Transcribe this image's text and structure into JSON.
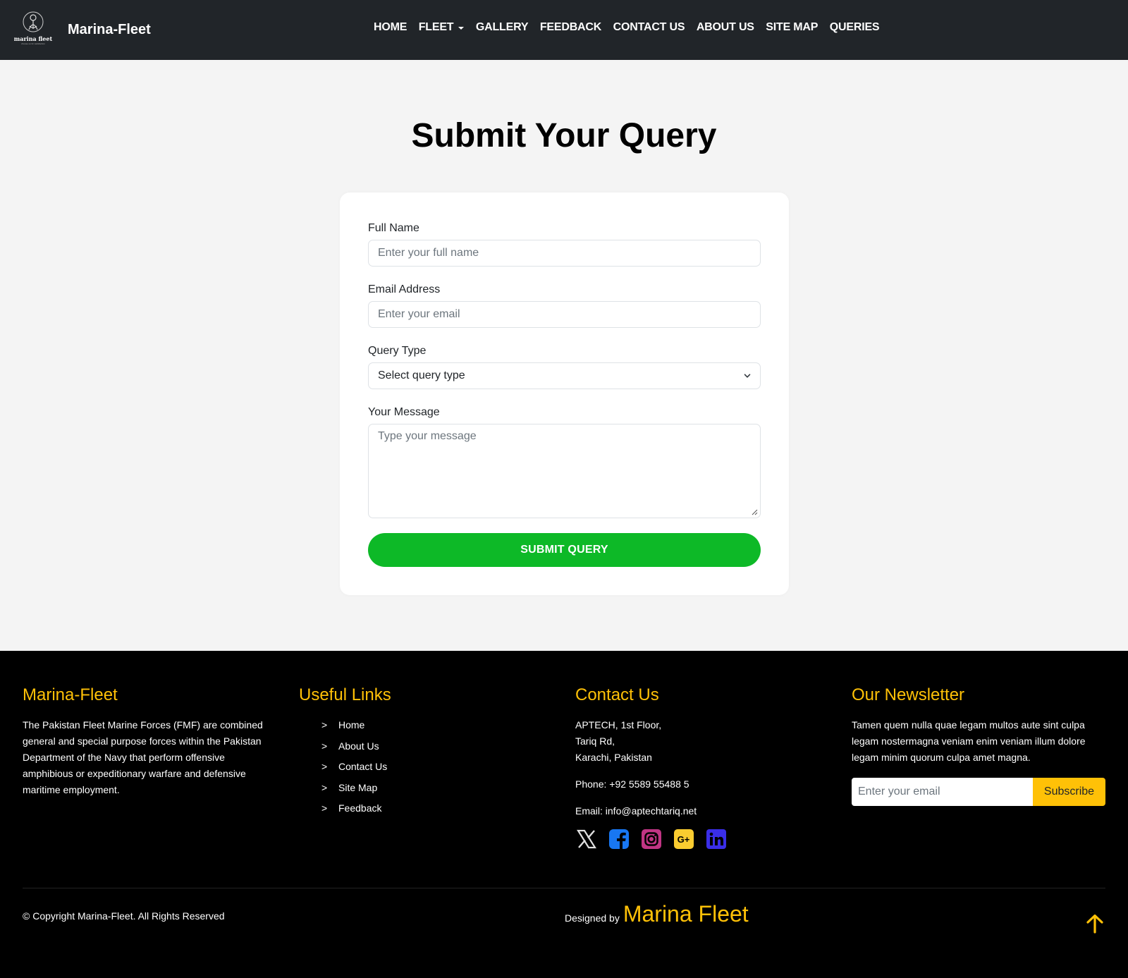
{
  "colors": {
    "navbar_bg": "#212529",
    "accent": "#ffc107",
    "submit_green": "#0db927",
    "footer_bg": "#000000"
  },
  "navbar": {
    "logo": {
      "text": "marina fleet",
      "tagline": "choose us for satisfaction",
      "icon": "anchor-sailor-icon"
    },
    "brand": "Marina-Fleet",
    "links": [
      "HOME",
      "FLEET",
      "GALLERY",
      "FEEDBACK",
      "CONTACT US",
      "ABOUT US",
      "SITE MAP",
      "QUERIES"
    ]
  },
  "main": {
    "title": "Submit Your Query",
    "form": {
      "full_name": {
        "label": "Full Name",
        "placeholder": "Enter your full name"
      },
      "email": {
        "label": "Email Address",
        "placeholder": "Enter your email"
      },
      "query_type": {
        "label": "Query Type",
        "selected": "Select query type",
        "icon": "chevron-down-icon"
      },
      "message": {
        "label": "Your Message",
        "placeholder": "Type your message"
      },
      "submit_label": "SUBMIT QUERY"
    }
  },
  "footer": {
    "about": {
      "title": "Marina-Fleet",
      "text": "The Pakistan Fleet Marine Forces (FMF) are combined general and special purpose forces within the Pakistan Department of the Navy that perform offensive amphibious or expeditionary warfare and defensive maritime employment."
    },
    "useful_links": {
      "title": "Useful Links",
      "bullet": ">",
      "items": [
        "Home",
        "About Us",
        "Contact Us",
        "Site Map",
        "Feedback"
      ]
    },
    "contact": {
      "title": "Contact Us",
      "address": [
        "APTECH, 1st Floor,",
        "Tariq Rd,",
        "Karachi, Pakistan"
      ],
      "phone": "Phone: +92 5589 55488 5",
      "email": "Email: info@aptechtariq.net",
      "socials": [
        "x-icon",
        "facebook-icon",
        "instagram-icon",
        "google-plus-icon",
        "linkedin-icon"
      ]
    },
    "newsletter": {
      "title": "Our Newsletter",
      "text": "Tamen quem nulla quae legam multos aute sint culpa legam nostermagna veniam enim veniam illum dolore legam minim quorum culpa amet magna.",
      "placeholder": "Enter your email",
      "button": "Subscribe"
    },
    "copyright": "© Copyright Marina-Fleet. All Rights Reserved",
    "designed_by": "Designed by",
    "designer": "Marina Fleet",
    "back_to_top_icon": "arrow-up-icon"
  }
}
